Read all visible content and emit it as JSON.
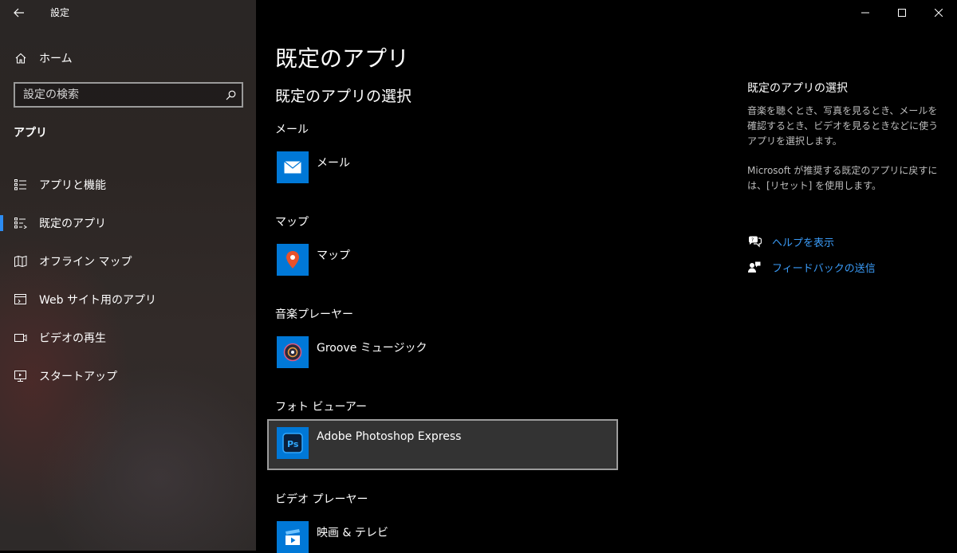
{
  "window": {
    "title": "設定",
    "back_icon": "back-arrow-icon",
    "controls": [
      "minimize-icon",
      "maximize-icon",
      "close-icon"
    ]
  },
  "sidebar": {
    "home_label": "ホーム",
    "search_placeholder": "設定の検索",
    "section_label": "アプリ",
    "items": [
      {
        "label": "アプリと機能",
        "icon": "apps-features-icon",
        "selected": false
      },
      {
        "label": "既定のアプリ",
        "icon": "default-apps-icon",
        "selected": true
      },
      {
        "label": "オフライン マップ",
        "icon": "offline-maps-icon",
        "selected": false
      },
      {
        "label": "Web サイト用のアプリ",
        "icon": "apps-for-websites-icon",
        "selected": false
      },
      {
        "label": "ビデオの再生",
        "icon": "video-playback-icon",
        "selected": false
      },
      {
        "label": "スタートアップ",
        "icon": "startup-icon",
        "selected": false
      }
    ]
  },
  "main": {
    "page_title": "既定のアプリ",
    "section_title": "既定のアプリの選択",
    "categories": [
      {
        "label": "メール",
        "app_name": "メール",
        "icon": "mail-app-icon",
        "icon_color": "#0078d7"
      },
      {
        "label": "マップ",
        "app_name": "マップ",
        "icon": "maps-app-icon",
        "icon_color": "#0078d7"
      },
      {
        "label": "音楽プレーヤー",
        "app_name": "Groove ミュージック",
        "icon": "groove-music-icon",
        "icon_color": "#0078d7"
      },
      {
        "label": "フォト ビューアー",
        "app_name": "Adobe Photoshop Express",
        "icon": "photoshop-express-icon",
        "icon_color": "#0078d7"
      },
      {
        "label": "ビデオ プレーヤー",
        "app_name": "映画 & テレビ",
        "icon": "movies-tv-icon",
        "icon_color": "#0078d7"
      }
    ]
  },
  "right_pane": {
    "title": "既定のアプリの選択",
    "description": "音楽を聴くとき、写真を見るとき、メールを確認するとき、ビデオを見るときなどに使うアプリを選択します。",
    "reset_note": "Microsoft が推奨する既定のアプリに戻すには、[リセット] を使用します。",
    "help_link": "ヘルプを表示",
    "feedback_link": "フィードバックの送信",
    "link_color": "#3a9bf7"
  },
  "colors": {
    "accent": "#0078d7",
    "selection_bar": "#2c8cf2",
    "background": "#000000"
  }
}
